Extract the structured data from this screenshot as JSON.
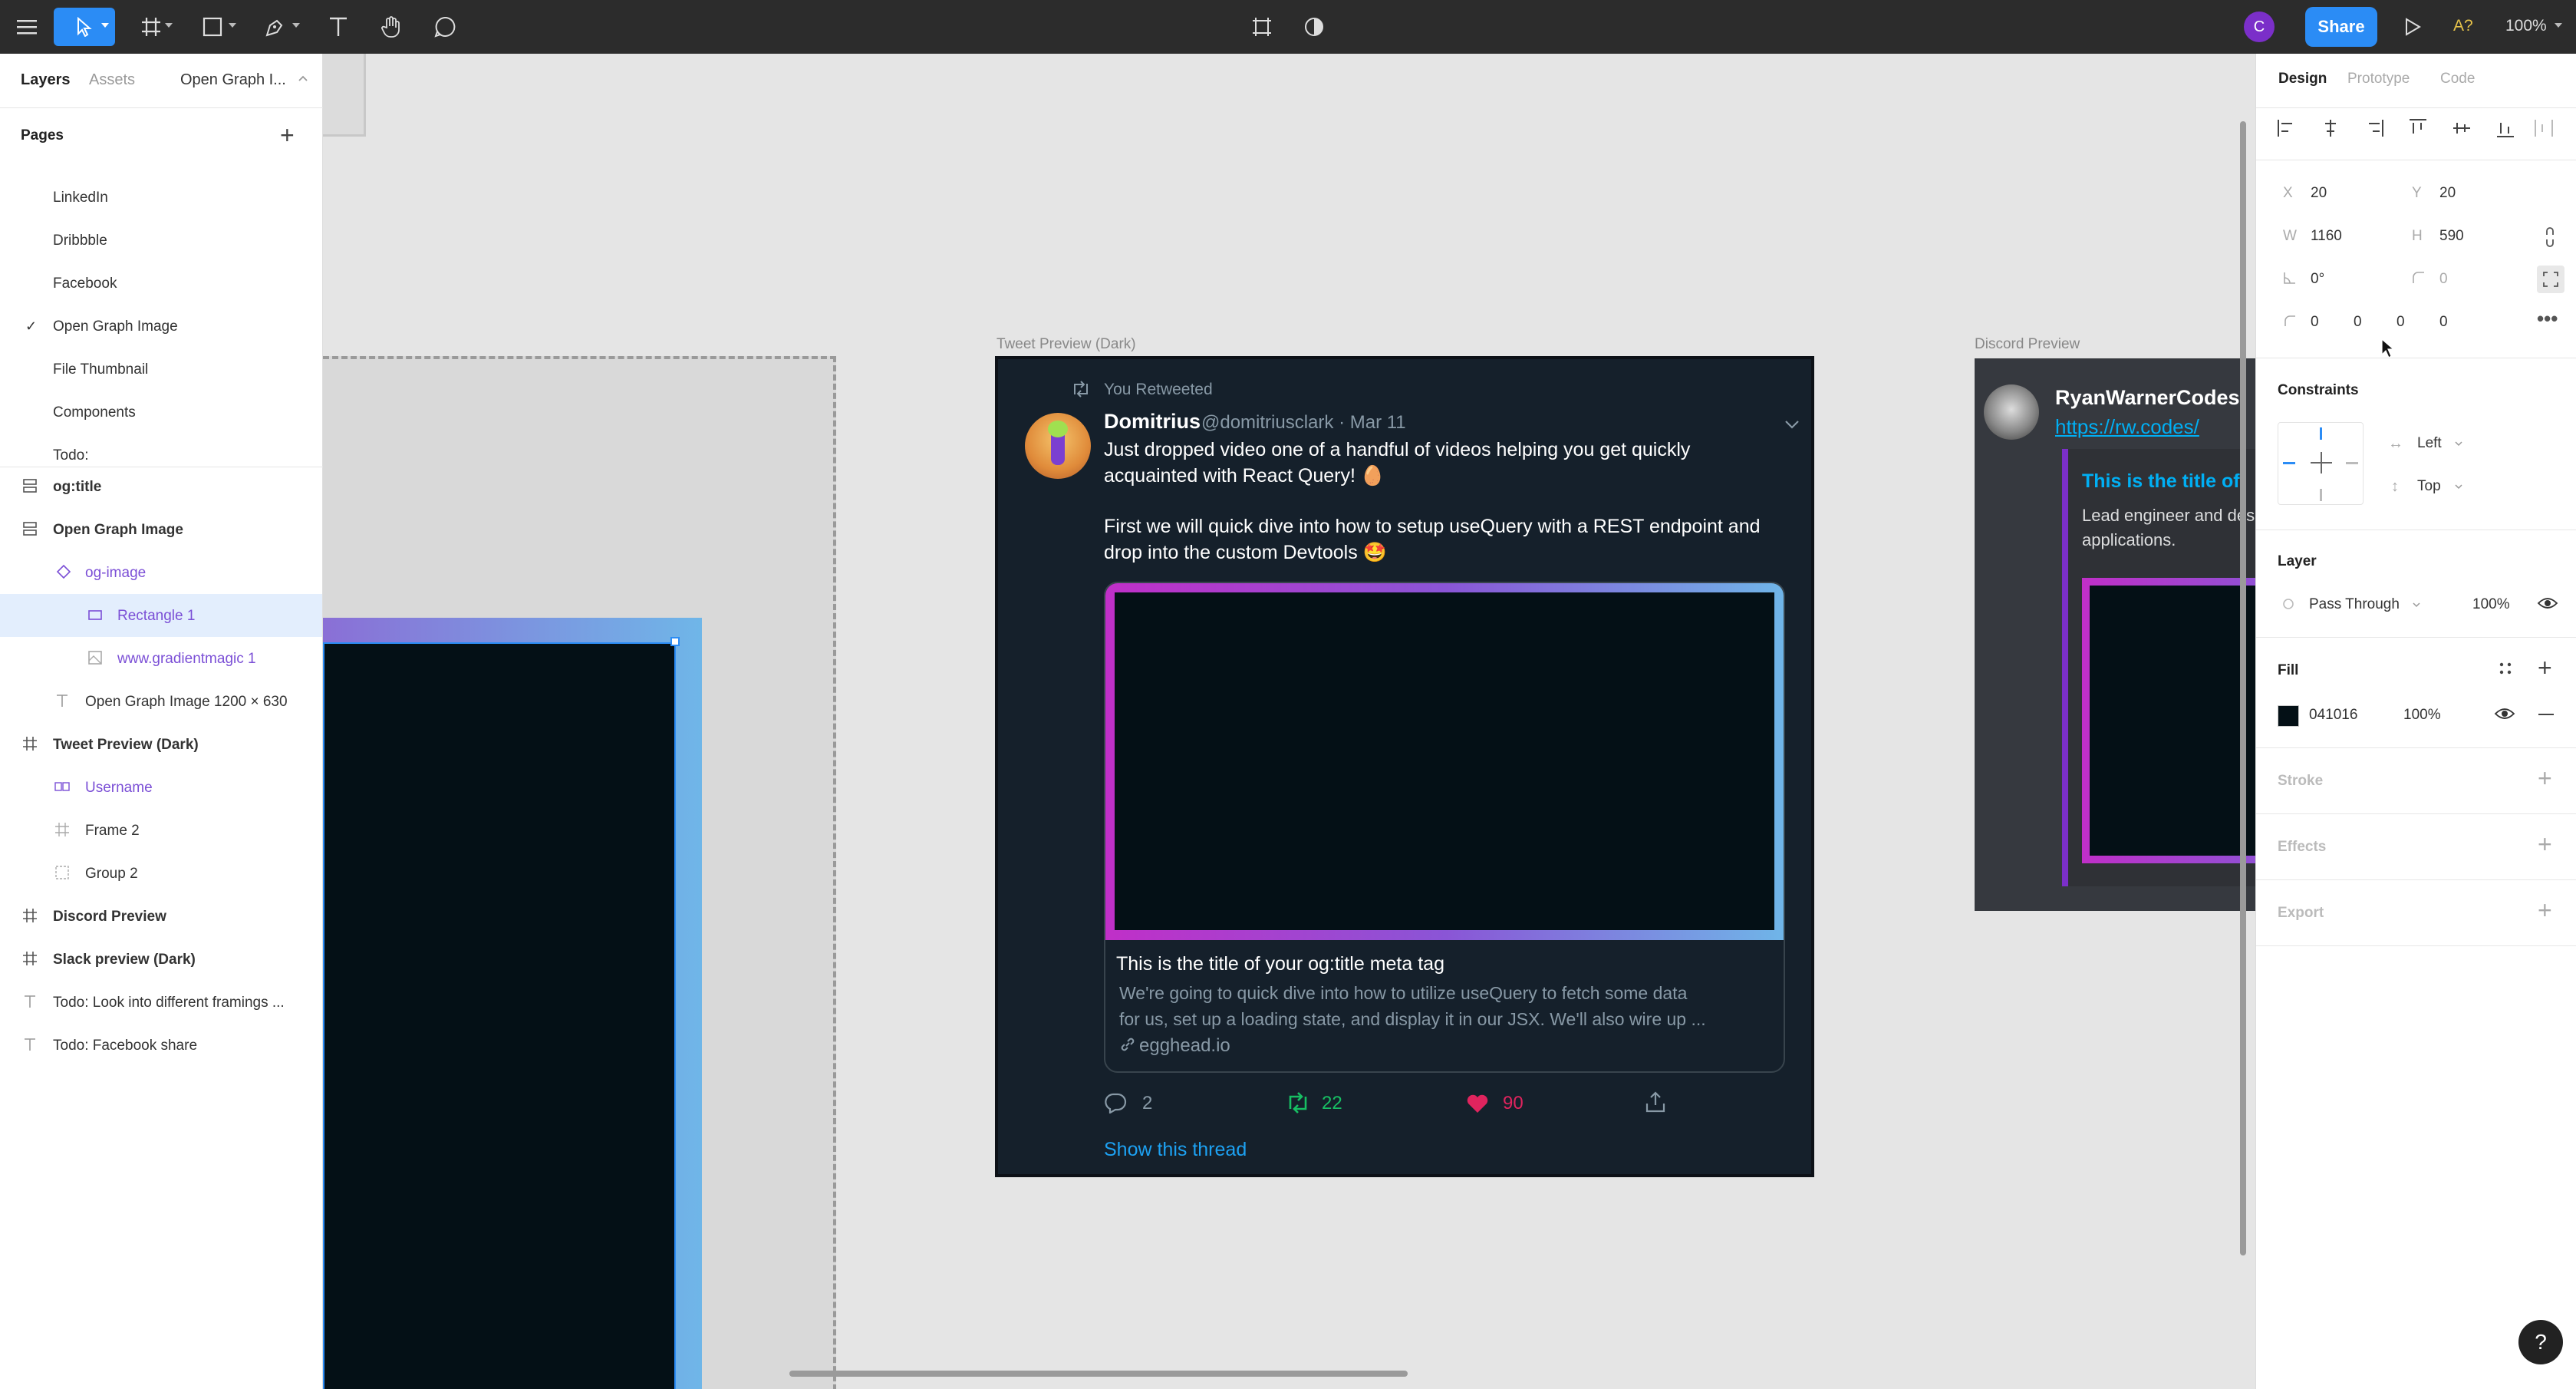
{
  "topbar": {
    "avatar_letter": "C",
    "share_label": "Share",
    "zoom": "100%",
    "missing_fonts": "A?"
  },
  "left_panel": {
    "tabs": [
      "Layers",
      "Assets",
      "Open Graph I..."
    ],
    "pages_header": "Pages",
    "pages": [
      "LinkedIn",
      "Dribbble",
      "Facebook",
      "Open Graph Image",
      "File Thumbnail",
      "Components",
      "Todo:"
    ],
    "current_page": "Open Graph Image",
    "layers": [
      {
        "label": "og:title",
        "icon": "text-stack-icon"
      },
      {
        "label": "Open Graph Image",
        "icon": "text-stack-icon"
      },
      {
        "label": "og-image",
        "icon": "component-instance-icon"
      },
      {
        "label": "Rectangle 1",
        "icon": "rectangle-icon"
      },
      {
        "label": "www.gradientmagic 1",
        "icon": "image-icon"
      },
      {
        "label": "Open Graph Image 1200 × 630",
        "icon": "text-icon"
      },
      {
        "label": "Tweet Preview (Dark)",
        "icon": "frame-icon"
      },
      {
        "label": "Username",
        "icon": "component-icon"
      },
      {
        "label": "Frame 2",
        "icon": "frame-icon"
      },
      {
        "label": "Group 2",
        "icon": "group-icon"
      },
      {
        "label": "Discord Preview",
        "icon": "frame-icon"
      },
      {
        "label": "Slack preview (Dark)",
        "icon": "frame-icon"
      },
      {
        "label": "Todo: Look into different framings ...",
        "icon": "text-icon"
      },
      {
        "label": "Todo: Facebook share",
        "icon": "text-icon"
      }
    ]
  },
  "canvas": {
    "tweet_frame_label": "Tweet Preview (Dark)",
    "discord_frame_label": "Discord Preview",
    "tweet": {
      "retweet_note": "You Retweeted",
      "name": "Domitrius",
      "handle_date": "@domitriusclark · Mar 11",
      "line1": "Just dropped video one of a handful of videos helping you get quickly",
      "line2": "acquainted with React Query! 🥚",
      "line3": "First we will quick dive into how to setup useQuery with a REST endpoint and",
      "line4": "drop into the custom Devtools 🤩",
      "card_title": "This is the title of your og:title meta tag",
      "card_desc1": "We're going to quick dive into how to utilize useQuery to fetch some data",
      "card_desc2": "for us, set up a loading state, and display it in our JSX. We'll also wire up ...",
      "card_domain": "egghead.io",
      "replies": "2",
      "retweets": "22",
      "likes": "90",
      "show_thread": "Show this thread"
    },
    "discord": {
      "username": "RyanWarnerCodes",
      "link": "https://rw.codes/",
      "embed_title": "This is the title of",
      "embed_desc1": "Lead engineer and des",
      "embed_desc2": "applications."
    }
  },
  "right_panel": {
    "tabs": [
      "Design",
      "Prototype",
      "Code"
    ],
    "x_label": "X",
    "x": "20",
    "y_label": "Y",
    "y": "20",
    "w_label": "W",
    "w": "1160",
    "h_label": "H",
    "h": "590",
    "rotation": "0°",
    "radius": "0",
    "corners": [
      "0",
      "0",
      "0",
      "0"
    ],
    "constraints_header": "Constraints",
    "constraint_h": "Left",
    "constraint_v": "Top",
    "layer_header": "Layer",
    "blend_mode": "Pass Through",
    "layer_opacity": "100%",
    "fill_header": "Fill",
    "fill_hex": "041016",
    "fill_opacity": "100%",
    "stroke_header": "Stroke",
    "effects_header": "Effects",
    "export_header": "Export"
  },
  "help": "?",
  "colors": {
    "topbar": "#2c2c2c",
    "share": "#2b8cf5",
    "selection": "#7b4fd6",
    "fill_swatch": "#041016",
    "tweet_bg": "#15202b",
    "twitter_blue": "#1da1f2"
  }
}
